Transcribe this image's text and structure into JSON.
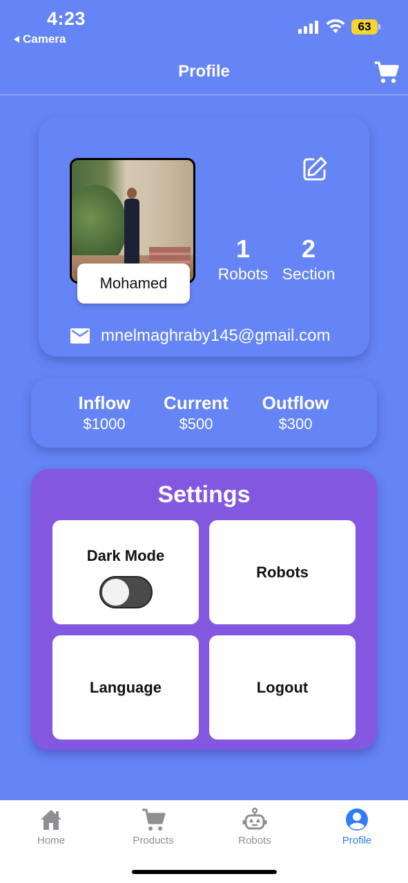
{
  "status_bar": {
    "time": "4:23",
    "back_app": "Camera",
    "battery": "63"
  },
  "header": {
    "title": "Profile",
    "cart_icon": "cart-icon"
  },
  "profile": {
    "name": "Mohamed",
    "email": "mnelmaghraby145@gmail.com",
    "stats": [
      {
        "value": "1",
        "label": "Robots"
      },
      {
        "value": "2",
        "label": "Section"
      }
    ],
    "edit_icon": "edit-icon",
    "mail_icon": "mail-icon"
  },
  "money": [
    {
      "label": "Inflow",
      "value": "$1000"
    },
    {
      "label": "Current",
      "value": "$500"
    },
    {
      "label": "Outflow",
      "value": "$300"
    }
  ],
  "settings": {
    "title": "Settings",
    "dark_mode_label": "Dark Mode",
    "dark_mode_on": false,
    "robots_label": "Robots",
    "language_label": "Language",
    "logout_label": "Logout"
  },
  "nav": {
    "items": [
      {
        "label": "Home",
        "icon": "home-icon"
      },
      {
        "label": "Products",
        "icon": "cart-icon"
      },
      {
        "label": "Robots",
        "icon": "robot-icon"
      },
      {
        "label": "Profile",
        "icon": "profile-icon",
        "active": true
      }
    ],
    "active_color": "#2e7cf6",
    "inactive_color": "#8e8e93"
  },
  "colors": {
    "background": "#6584f5",
    "settings_card": "#8457e0",
    "battery": "#f6d433"
  }
}
